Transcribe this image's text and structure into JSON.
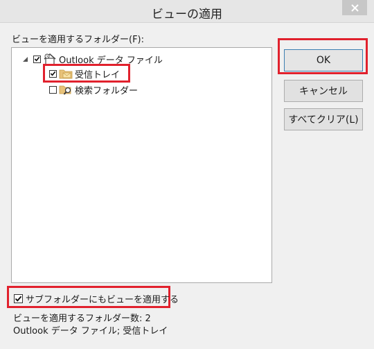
{
  "window": {
    "title": "ビューの適用"
  },
  "folders_label": "ビューを適用するフォルダー(F):",
  "tree": {
    "root": {
      "label": "Outlook データ ファイル",
      "checked": true,
      "expanded": true
    },
    "children": [
      {
        "label": "受信トレイ",
        "checked": true
      },
      {
        "label": "検索フォルダー",
        "checked": false
      }
    ]
  },
  "buttons": {
    "ok": "OK",
    "cancel": "キャンセル",
    "clear_all": "すべてクリア(L)"
  },
  "apply_subfolders": {
    "label": "サブフォルダーにもビューを適用する",
    "checked": true
  },
  "summary": {
    "count_line": "ビューを適用するフォルダー数: 2",
    "names_line": "Outlook データ ファイル; 受信トレイ"
  },
  "colors": {
    "highlight": "#e1212d",
    "default_button_border": "#3c7fb1"
  }
}
